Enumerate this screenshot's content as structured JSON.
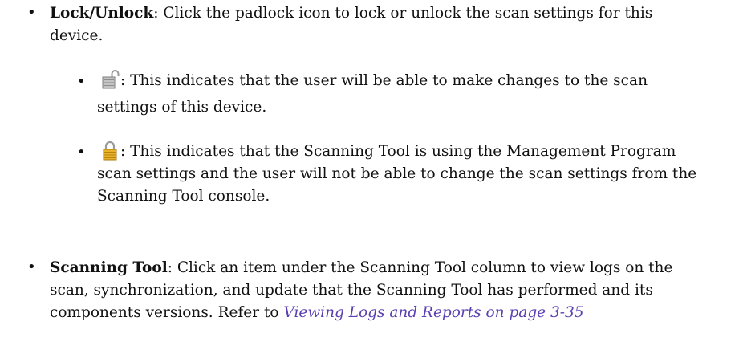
{
  "bullets": {
    "char": "•"
  },
  "lock_unlock": {
    "term": "Lock/Unlock",
    "text_line1": ": Click the padlock icon to lock or unlock the scan settings for this",
    "text_line2": "device."
  },
  "unlocked": {
    "icon": "unlocked-padlock-icon",
    "text_line1": ": This indicates that the user will be able to make changes to the scan",
    "text_line2": "settings of this device."
  },
  "locked": {
    "icon": "locked-padlock-icon",
    "text_line1": ": This indicates that the Scanning Tool is using the Management Program",
    "text_line2": "scan settings and the user will not be able to change the scan settings from the",
    "text_line3": "Scanning Tool console."
  },
  "scanning_tool": {
    "term": "Scanning Tool",
    "text_line1": ": Click an item under the Scanning Tool column to view logs on the",
    "text_line2": "scan, synchronization, and update that the Scanning Tool has performed and its",
    "text_line3": "components versions. Refer to ",
    "link": "Viewing Logs and Reports on page 3-35"
  },
  "colors": {
    "link": "#5a3fb0",
    "lock_gold": "#e2a91e",
    "lock_grey": "#b9b9b9"
  }
}
